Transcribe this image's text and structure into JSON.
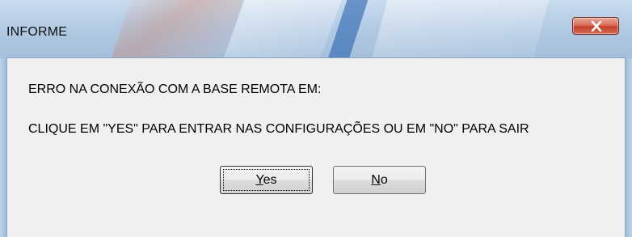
{
  "window": {
    "title": "INFORME",
    "close_icon": "close-x-icon"
  },
  "message": {
    "line1": "ERRO NA CONEXÃO COM A BASE REMOTA EM:",
    "line2": "CLIQUE EM \"YES\" PARA ENTRAR NAS CONFIGURAÇÕES OU EM \"NO\" PARA SAIR"
  },
  "buttons": {
    "yes": {
      "mnemonic": "Y",
      "rest": "es"
    },
    "no": {
      "mnemonic": "N",
      "rest": "o"
    }
  },
  "colors": {
    "close_button": "#c2412d",
    "client_background": "#f0f0f0",
    "frame": "#9fbcd9"
  }
}
